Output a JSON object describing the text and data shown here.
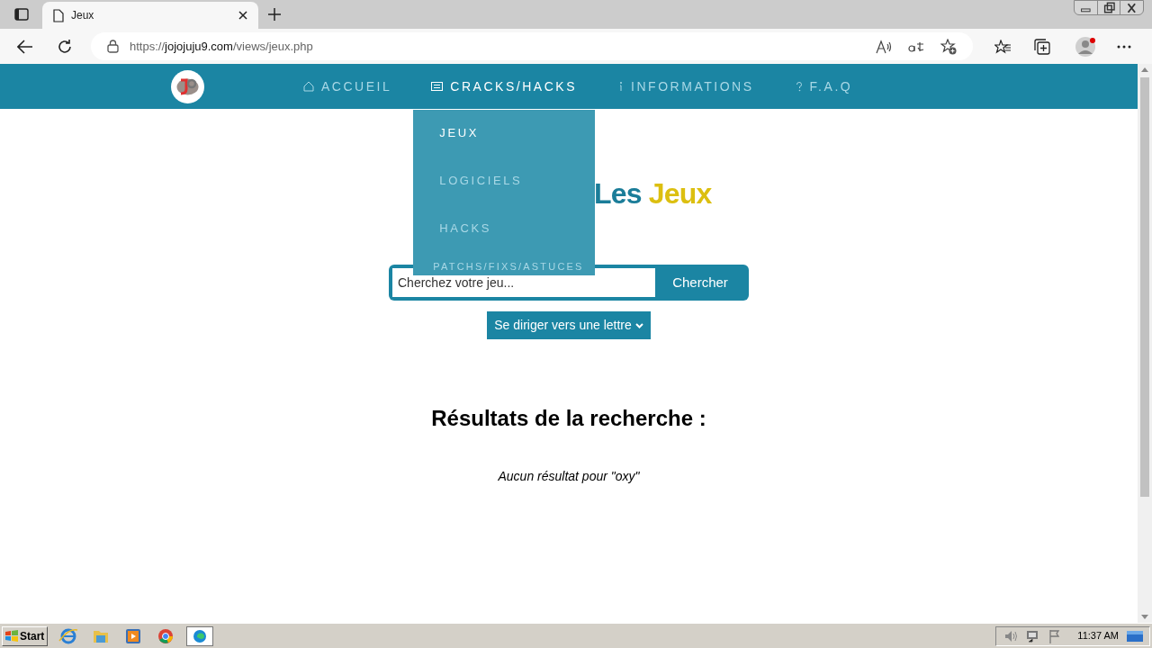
{
  "browser": {
    "tab_title": "Jeux",
    "url_scheme": "https://",
    "url_host": "jojojuju9.com",
    "url_path": "/views/jeux.php"
  },
  "nav": {
    "items": [
      {
        "label": "ACCUEIL",
        "selected": false
      },
      {
        "label": "CRACKS/HACKS",
        "selected": true
      },
      {
        "label": "INFORMATIONS",
        "selected": false
      },
      {
        "label": "F.A.Q",
        "selected": false
      }
    ],
    "dropdown": [
      {
        "label": "JEUX",
        "selected": true
      },
      {
        "label": "LOGICIELS",
        "selected": false
      },
      {
        "label": "HACKS",
        "selected": false
      },
      {
        "label": "PATCHS/FIXS/ASTUCES",
        "selected": false
      }
    ]
  },
  "page": {
    "title": [
      "Les",
      "Jeux"
    ],
    "search": {
      "placeholder": "Cherchez votre jeu...",
      "button": "Chercher"
    },
    "letter_select": "Se diriger vers une lettre",
    "results_heading": "Résultats de la recherche :",
    "results_message": "Aucun résultat pour \"oxy\""
  },
  "taskbar": {
    "start": "Start",
    "clock": "11:37 AM"
  }
}
